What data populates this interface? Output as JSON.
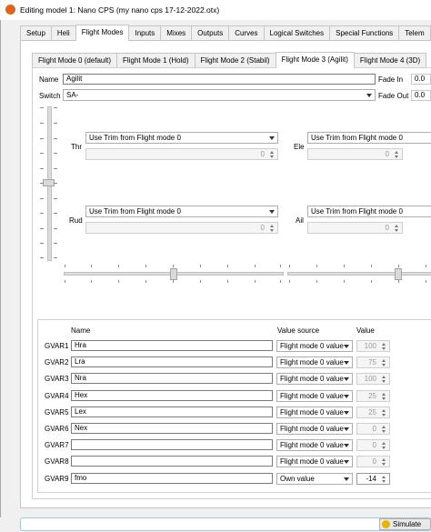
{
  "window": {
    "title": "Editing model 1: Nano CPS   (my nano cps 17-12-2022.otx)"
  },
  "main_tabs": [
    "Setup",
    "Heli",
    "Flight Modes",
    "Inputs",
    "Mixes",
    "Outputs",
    "Curves",
    "Logical Switches",
    "Special Functions",
    "Telem"
  ],
  "main_tabs_active": "Flight Modes",
  "fm_tabs": [
    "Flight Mode 0 (default)",
    "Flight Mode 1 (Hold)",
    "Flight Mode 2 (Stabil)",
    "Flight Mode 3 (Agilit)",
    "Flight Mode 4 (3D)"
  ],
  "fm_tabs_active": "Flight Mode 3 (Agilit)",
  "form": {
    "name_label": "Name",
    "name_value": "Agilit",
    "switch_label": "Switch",
    "switch_value": "SA-",
    "fade_in_label": "Fade In",
    "fade_in_value": "0.0",
    "fade_out_label": "Fade Out",
    "fade_out_value": "0.0"
  },
  "trims": {
    "thr": {
      "label": "Thr",
      "mode": "Use Trim from Flight mode 0",
      "value": "0"
    },
    "ele": {
      "label": "Ele",
      "mode": "Use Trim from Flight mode 0",
      "value": "0"
    },
    "rud": {
      "label": "Rud",
      "mode": "Use Trim from Flight mode 0",
      "value": "0"
    },
    "ail": {
      "label": "Ail",
      "mode": "Use Trim from Flight mode 0",
      "value": "0"
    }
  },
  "gvars": {
    "headers": {
      "name": "Name",
      "source": "Value source",
      "value": "Value"
    },
    "rows": [
      {
        "id": "GVAR1",
        "name": "Hra",
        "source": "Flight mode 0 value",
        "value": "100"
      },
      {
        "id": "GVAR2",
        "name": "Lra",
        "source": "Flight mode 0 value",
        "value": "75"
      },
      {
        "id": "GVAR3",
        "name": "Nra",
        "source": "Flight mode 0 value",
        "value": "100"
      },
      {
        "id": "GVAR4",
        "name": "Hex",
        "source": "Flight mode 0 value",
        "value": "25"
      },
      {
        "id": "GVAR5",
        "name": "Lex",
        "source": "Flight mode 0 value",
        "value": "25"
      },
      {
        "id": "GVAR6",
        "name": "Nex",
        "source": "Flight mode 0 value",
        "value": "0"
      },
      {
        "id": "GVAR7",
        "name": "",
        "source": "Flight mode 0 value",
        "value": "0"
      },
      {
        "id": "GVAR8",
        "name": "",
        "source": "Flight mode 0 value",
        "value": "0"
      },
      {
        "id": "GVAR9",
        "name": "fmo",
        "source": "Own value",
        "value": "-14"
      }
    ]
  },
  "status": {
    "simulate_label": "Simulate"
  }
}
